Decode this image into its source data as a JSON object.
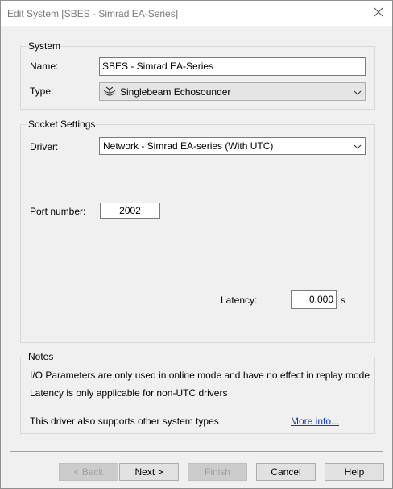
{
  "window": {
    "title": "Edit System [SBES - Simrad EA-Series]",
    "close_icon": "close-icon"
  },
  "system": {
    "group_title": "System",
    "name_label": "Name:",
    "name_value": "SBES - Simrad EA-Series",
    "type_label": "Type:",
    "type_value": "Singlebeam Echosounder",
    "type_icon": "singlebeam-echosounder-icon"
  },
  "socket": {
    "group_title": "Socket Settings",
    "driver_label": "Driver:",
    "driver_value": "Network - Simrad EA-series (With UTC)",
    "port_label": "Port number:",
    "port_value": "2002",
    "latency_label": "Latency:",
    "latency_value": "0.000",
    "latency_unit": "s"
  },
  "notes": {
    "group_title": "Notes",
    "line1": "I/O Parameters are only used in online mode and have no effect in replay mode",
    "line2": "Latency is only applicable for non-UTC drivers",
    "line3": "This driver also supports other system types",
    "more_info_link": "More info..."
  },
  "buttons": {
    "back": "< Back",
    "next": "Next >",
    "finish": "Finish",
    "cancel": "Cancel",
    "help": "Help"
  }
}
